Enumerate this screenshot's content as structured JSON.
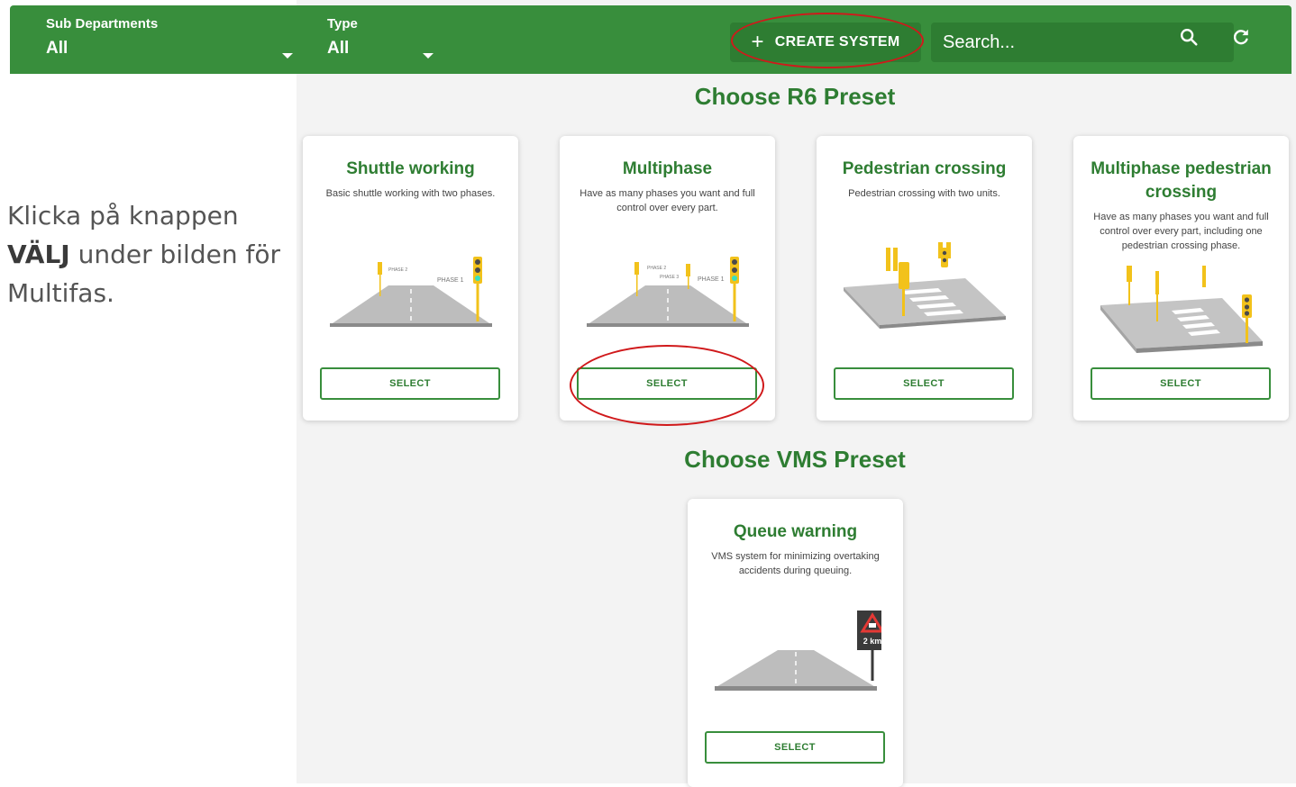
{
  "topbar": {
    "sub_departments_label": "Sub Departments",
    "sub_departments_value": "All",
    "type_label": "Type",
    "type_value": "All",
    "create_button": "CREATE SYSTEM",
    "search_placeholder": "Search...",
    "icons": {
      "create": "plus-icon",
      "search": "search-icon",
      "refresh": "refresh-icon",
      "dropdown": "caret-down-icon"
    }
  },
  "instruction": {
    "line1": "Klicka på knappen",
    "bold": "VÄLJ",
    "line2_rest": " under bilden för",
    "line3": "Multifas."
  },
  "r6": {
    "title": "Choose R6 Preset",
    "cards": [
      {
        "title": "Shuttle working",
        "desc": "Basic shuttle working with two phases.",
        "select": "SELECT",
        "img_labels": [
          "PHASE 2",
          "PHASE 1"
        ]
      },
      {
        "title": "Multiphase",
        "desc": "Have as many phases you want and full control over every part.",
        "select": "SELECT",
        "img_labels": [
          "PHASE 2",
          "PHASE 3",
          "PHASE 1"
        ]
      },
      {
        "title": "Pedestrian crossing",
        "desc": "Pedestrian crossing with two units.",
        "select": "SELECT"
      },
      {
        "title": "Multiphase pedestrian crossing",
        "desc": "Have as many phases you want and full control over every part, including one pedestrian crossing phase.",
        "select": "SELECT"
      }
    ]
  },
  "vms": {
    "title": "Choose VMS Preset",
    "cards": [
      {
        "title": "Queue warning",
        "desc": "VMS system for minimizing overtaking accidents during queuing.",
        "select": "SELECT",
        "sign_text": "2 km"
      }
    ]
  },
  "colors": {
    "brand_green": "#388e3c",
    "dark_green": "#2e7d32",
    "annotation_red": "#d0191b",
    "traffic_yellow": "#f2c21b"
  }
}
